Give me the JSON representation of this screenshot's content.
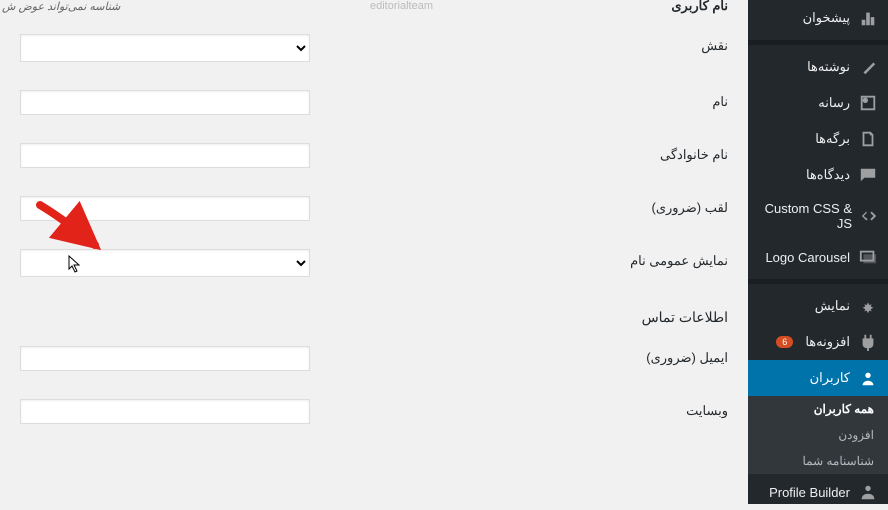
{
  "sidebar": {
    "items": [
      {
        "label": "پیشخوان",
        "icon": "dashboard"
      },
      {
        "label": "نوشته‌ها",
        "icon": "pin"
      },
      {
        "label": "رسانه",
        "icon": "media"
      },
      {
        "label": "برگه‌ها",
        "icon": "pages"
      },
      {
        "label": "دیدگاه‌ها",
        "icon": "comments"
      },
      {
        "label": "Custom CSS & JS",
        "icon": "code"
      },
      {
        "label": "Logo Carousel",
        "icon": "images"
      },
      {
        "label": "نمایش",
        "icon": "appearance"
      },
      {
        "label": "افزونه‌ها",
        "icon": "plugins",
        "badge": "6"
      },
      {
        "label": "کاربران",
        "icon": "users"
      },
      {
        "label": "Profile Builder",
        "icon": "profile"
      }
    ],
    "submenu": [
      {
        "label": "همه کاربران"
      },
      {
        "label": "افزودن"
      },
      {
        "label": "شناسنامه شما"
      }
    ]
  },
  "form": {
    "title_cropped": "نام کاربری",
    "hint": "شناسه نمی‌تواند عوض ش",
    "editorial": "editorialteam",
    "role_label": "نقش",
    "first_name_label": "نام",
    "last_name_label": "نام خانوادگی",
    "nickname_label": "لقب (ضروری)",
    "display_name_label": "نمایش عمومی نام",
    "contact_heading": "اطلاعات تماس",
    "email_label": "ایمیل (ضروری)",
    "website_label": "وبسایت"
  }
}
